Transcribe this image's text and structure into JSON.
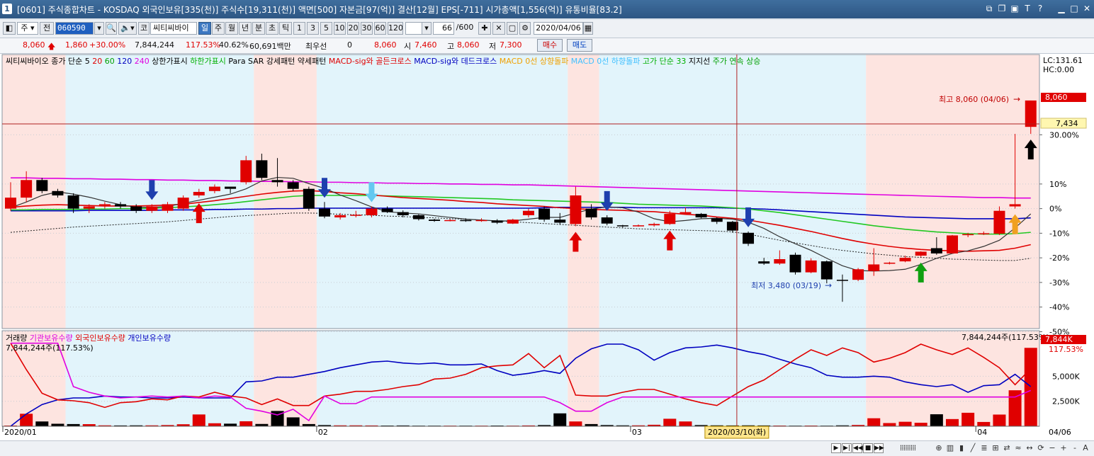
{
  "window": {
    "number": "1",
    "title": "[0601] 주식종합차트 - KOSDAQ 외국인보유[335(천)] 주식수[19,311(천)] 액면[500] 자본금[97(억)] 결산[12월] EPS[-711] 시가총액[1,556(억)] 유통비율[83.2]"
  },
  "toolbar": {
    "type_select": "주",
    "prev_label": "전",
    "code": "060590",
    "market": "코",
    "stock_name": "씨티씨바이",
    "periods": [
      "일",
      "주",
      "월",
      "년",
      "분",
      "초",
      "틱"
    ],
    "selected_period": "일",
    "intervals": [
      "1",
      "3",
      "5",
      "10",
      "20",
      "30",
      "60",
      "120"
    ],
    "count": "66",
    "count_total": "/600",
    "date": "2020/04/06"
  },
  "quote": {
    "price": "8,060",
    "change": "1,860",
    "change_pct": "+30.00%",
    "volume": "7,844,244",
    "vol_ratio": "117.53%",
    "turnover": "40.62%",
    "amount": "60,691백만",
    "priority_label": "최우선",
    "priority_value": "0",
    "ask": "8,060",
    "open_label": "시",
    "open": "7,460",
    "high_label": "고",
    "high": "8,060",
    "low_label": "저",
    "low": "7,300",
    "buy_label": "매수",
    "sell_label": "매도"
  },
  "price_panel": {
    "legend": [
      {
        "text": "씨티씨바이오",
        "color": "#000000"
      },
      {
        "text": "종가 단순 5",
        "color": "#000000"
      },
      {
        "text": "20",
        "color": "#e00000"
      },
      {
        "text": "60",
        "color": "#00a000"
      },
      {
        "text": "120",
        "color": "#0000c0"
      },
      {
        "text": "240",
        "color": "#e000e0"
      },
      {
        "text": "상한가표시",
        "color": "#000000"
      },
      {
        "text": "하한가표시",
        "color": "#00b000"
      },
      {
        "text": "Para SAR 강세패턴",
        "color": "#000000"
      },
      {
        "text": "약세패턴",
        "color": "#000000"
      },
      {
        "text": "MACD-sig와 골든크로스",
        "color": "#e00000"
      },
      {
        "text": "MACD-sig와 데드크로스",
        "color": "#0000c0"
      },
      {
        "text": "MACD 0선 상향돌파",
        "color": "#f0a000"
      },
      {
        "text": "MACD 0선 하향돌파",
        "color": "#40c0ff"
      },
      {
        "text": "고가 단순 33",
        "color": "#00b000"
      },
      {
        "text": "지지선",
        "color": "#000000"
      },
      {
        "text": "주가 연속 상승",
        "color": "#00a000"
      }
    ],
    "lc": "LC:131.61",
    "hc": "HC:0.00",
    "last_price_tag": "8,060",
    "cursor_tag": "7,434",
    "max_label": "최고 8,060 (04/06)",
    "min_label": "최저 3,480 (03/19)",
    "y_ticks": [
      "30.00%",
      "10%",
      "0%",
      "-10%",
      "-20%",
      "-30%",
      "-40%",
      "-50%"
    ]
  },
  "volume_panel": {
    "legend": [
      {
        "text": "거래량",
        "color": "#000000"
      },
      {
        "text": "기관보유수량",
        "color": "#e000e0"
      },
      {
        "text": "외국인보유수량",
        "color": "#e00000"
      },
      {
        "text": "개인보유수량",
        "color": "#0000c0"
      }
    ],
    "left_label": "7,844,244주(117.53%)",
    "right_label": "7,844,244주(117.53%)",
    "tag_value": "7,844K",
    "tag_pct": "117.53%",
    "y_ticks": [
      "5,000K",
      "2,500K"
    ]
  },
  "x_axis": {
    "labels": [
      "2020/01",
      "02",
      "03",
      "04"
    ],
    "last_label": "04/06",
    "cursor_label": "2020/03/10(화)"
  },
  "colors": {
    "up": "#e00000",
    "down": "#000000",
    "bg_pink": "#fde4e0",
    "bg_blue": "#e2f4fb"
  },
  "chart_data": {
    "type": "candlestick",
    "series_name": "씨티씨바이오",
    "ohlc": [
      [
        5600,
        6200,
        5550,
        5850
      ],
      [
        5850,
        6450,
        5750,
        6250
      ],
      [
        6250,
        6300,
        5950,
        6000
      ],
      [
        6000,
        6050,
        5850,
        5900
      ],
      [
        5900,
        5950,
        5500,
        5600
      ],
      [
        5600,
        5700,
        5500,
        5650
      ],
      [
        5650,
        5750,
        5600,
        5700
      ],
      [
        5700,
        5750,
        5600,
        5650
      ],
      [
        5650,
        5700,
        5500,
        5550
      ],
      [
        5550,
        5700,
        5500,
        5650
      ],
      [
        5550,
        5750,
        5500,
        5700
      ],
      [
        5600,
        5900,
        5550,
        5850
      ],
      [
        5900,
        6050,
        5850,
        5980
      ],
      [
        6000,
        6150,
        5950,
        6100
      ],
      [
        6100,
        6050,
        5950,
        6050
      ],
      [
        6200,
        6800,
        6150,
        6700
      ],
      [
        6700,
        6850,
        6250,
        6300
      ],
      [
        6250,
        6750,
        6100,
        6200
      ],
      [
        6200,
        6250,
        6000,
        6050
      ],
      [
        6050,
        6100,
        5550,
        5600
      ],
      [
        5600,
        5750,
        5380,
        5420
      ],
      [
        5400,
        5500,
        5350,
        5450
      ],
      [
        5450,
        5550,
        5400,
        5460
      ],
      [
        5450,
        5650,
        5400,
        5600
      ],
      [
        5600,
        5650,
        5500,
        5520
      ],
      [
        5520,
        5560,
        5400,
        5450
      ],
      [
        5450,
        5470,
        5330,
        5360
      ],
      [
        5350,
        5370,
        5300,
        5320
      ],
      [
        5320,
        5360,
        5310,
        5340
      ],
      [
        5340,
        5380,
        5300,
        5320
      ],
      [
        5330,
        5380,
        5300,
        5340
      ],
      [
        5330,
        5360,
        5250,
        5280
      ],
      [
        5260,
        5370,
        5250,
        5350
      ],
      [
        5450,
        5600,
        5400,
        5550
      ],
      [
        5600,
        5650,
        5300,
        5350
      ],
      [
        5350,
        5500,
        5230,
        5280
      ],
      [
        5250,
        6100,
        5200,
        5900
      ],
      [
        5600,
        5700,
        5350,
        5400
      ],
      [
        5400,
        5450,
        5220,
        5260
      ],
      [
        5220,
        5230,
        5170,
        5200
      ],
      [
        5220,
        5240,
        5190,
        5220
      ],
      [
        5220,
        5280,
        5190,
        5250
      ],
      [
        5250,
        5550,
        5230,
        5480
      ],
      [
        5480,
        5620,
        5460,
        5520
      ],
      [
        5480,
        5500,
        5380,
        5400
      ],
      [
        5380,
        5400,
        5250,
        5300
      ],
      [
        5300,
        5320,
        5050,
        5100
      ],
      [
        5050,
        5080,
        4750,
        4800
      ],
      [
        4400,
        4480,
        4320,
        4350
      ],
      [
        4350,
        4650,
        4320,
        4450
      ],
      [
        4550,
        4600,
        4100,
        4150
      ],
      [
        4150,
        4470,
        4130,
        4420
      ],
      [
        4400,
        4420,
        3900,
        3990
      ],
      [
        3980,
        4100,
        3480,
        3970
      ],
      [
        3980,
        4250,
        3950,
        4220
      ],
      [
        4180,
        4700,
        4070,
        4330
      ],
      [
        4350,
        4390,
        4330,
        4370
      ],
      [
        4400,
        4530,
        4380,
        4480
      ],
      [
        4530,
        4630,
        4500,
        4620
      ],
      [
        4700,
        4950,
        4550,
        4580
      ],
      [
        4580,
        5000,
        4580,
        4990
      ],
      [
        5010,
        5050,
        4950,
        5020
      ],
      [
        5020,
        5080,
        5000,
        5040
      ],
      [
        5030,
        5650,
        5000,
        5550
      ],
      [
        5650,
        7300,
        5600,
        5700
      ],
      [
        7460,
        8060,
        7300,
        8060
      ]
    ],
    "volume": [
      70,
      1250,
      480,
      250,
      220,
      210,
      90,
      80,
      90,
      90,
      120,
      200,
      1180,
      300,
      260,
      500,
      230,
      1530,
      890,
      220,
      120,
      90,
      90,
      80,
      70,
      80,
      60,
      60,
      60,
      60,
      60,
      70,
      60,
      80,
      120,
      1290,
      480,
      220,
      120,
      90,
      90,
      150,
      750,
      480,
      120,
      90,
      80,
      90,
      80,
      70,
      60,
      70,
      60,
      90,
      130,
      800,
      320,
      450,
      350,
      1200,
      720,
      1350,
      430,
      1170,
      3600,
      7844
    ],
    "ma": {
      "5": [
        5620,
        5750,
        5900,
        5980,
        5930,
        5860,
        5770,
        5690,
        5630,
        5630,
        5650,
        5720,
        5790,
        5860,
        5930,
        6050,
        6230,
        6310,
        6290,
        6170,
        6060,
        5910,
        5780,
        5640,
        5530,
        5500,
        5480,
        5440,
        5400,
        5360,
        5340,
        5320,
        5320,
        5360,
        5400,
        5400,
        5500,
        5590,
        5640,
        5620,
        5520,
        5370,
        5300,
        5330,
        5370,
        5380,
        5360,
        5290,
        5150,
        4960,
        4800,
        4650,
        4470,
        4300,
        4190,
        4180,
        4190,
        4220,
        4330,
        4470,
        4580,
        4640,
        4740,
        4880,
        5160,
        5480
      ],
      "20": [
        5630,
        5660,
        5680,
        5690,
        5680,
        5670,
        5660,
        5660,
        5660,
        5670,
        5680,
        5700,
        5740,
        5780,
        5830,
        5880,
        5930,
        5970,
        6000,
        6010,
        5990,
        5960,
        5940,
        5910,
        5880,
        5850,
        5830,
        5810,
        5790,
        5760,
        5740,
        5710,
        5690,
        5670,
        5650,
        5620,
        5600,
        5580,
        5570,
        5560,
        5540,
        5530,
        5500,
        5470,
        5450,
        5410,
        5380,
        5340,
        5280,
        5220,
        5150,
        5080,
        5000,
        4920,
        4850,
        4790,
        4740,
        4700,
        4670,
        4650,
        4640,
        4630,
        4640,
        4650,
        4700,
        4780
      ],
      "60": [
        5570,
        5570,
        5580,
        5580,
        5580,
        5590,
        5590,
        5600,
        5600,
        5610,
        5620,
        5640,
        5660,
        5690,
        5720,
        5760,
        5800,
        5840,
        5880,
        5900,
        5900,
        5900,
        5900,
        5900,
        5890,
        5880,
        5870,
        5860,
        5850,
        5840,
        5830,
        5820,
        5800,
        5790,
        5780,
        5770,
        5760,
        5750,
        5740,
        5720,
        5700,
        5690,
        5680,
        5670,
        5660,
        5640,
        5620,
        5590,
        5550,
        5510,
        5460,
        5410,
        5360,
        5310,
        5260,
        5210,
        5170,
        5130,
        5100,
        5070,
        5050,
        5030,
        5020,
        5020,
        5030,
        5060
      ],
      "120": [
        5550,
        5550,
        5550,
        5550,
        5550,
        5560,
        5560,
        5560,
        5560,
        5560,
        5570,
        5570,
        5570,
        5580,
        5580,
        5590,
        5590,
        5600,
        5600,
        5610,
        5610,
        5610,
        5610,
        5610,
        5610,
        5610,
        5610,
        5610,
        5610,
        5610,
        5610,
        5610,
        5610,
        5610,
        5620,
        5630,
        5630,
        5630,
        5630,
        5630,
        5620,
        5620,
        5620,
        5620,
        5620,
        5620,
        5610,
        5600,
        5590,
        5570,
        5550,
        5530,
        5510,
        5490,
        5470,
        5450,
        5430,
        5410,
        5400,
        5390,
        5380,
        5370,
        5370,
        5370,
        5370,
        5390
      ],
      "240": [
        6300,
        6300,
        6290,
        6290,
        6280,
        6280,
        6270,
        6270,
        6260,
        6260,
        6250,
        6250,
        6240,
        6240,
        6230,
        6230,
        6220,
        6220,
        6210,
        6210,
        6200,
        6200,
        6190,
        6190,
        6180,
        6180,
        6170,
        6170,
        6160,
        6160,
        6150,
        6150,
        6140,
        6140,
        6130,
        6120,
        6110,
        6100,
        6090,
        6080,
        6070,
        6060,
        6050,
        6040,
        6030,
        6020,
        6010,
        6000,
        5990,
        5980,
        5970,
        5960,
        5950,
        5940,
        5930,
        5920,
        5910,
        5900,
        5890,
        5880,
        5870,
        5860,
        5850,
        5850,
        5840,
        5840
      ]
    },
    "support_line": [
      5060,
      5090,
      5120,
      5150,
      5180,
      5200,
      5220,
      5240,
      5260,
      5280,
      5300,
      5330,
      5360,
      5390,
      5420,
      5440,
      5460,
      5480,
      5500,
      5500,
      5490,
      5470,
      5460,
      5450,
      5430,
      5420,
      5400,
      5390,
      5370,
      5360,
      5340,
      5320,
      5300,
      5280,
      5260,
      5240,
      5220,
      5200,
      5180,
      5160,
      5140,
      5130,
      5120,
      5110,
      5100,
      5090,
      5070,
      5020,
      4950,
      4880,
      4820,
      4760,
      4700,
      4650,
      4610,
      4570,
      4540,
      4510,
      4490,
      4470,
      4450,
      4440,
      4430,
      4420,
      4420,
      4470
    ],
    "holdings": {
      "institution": [
        8.8,
        8.8,
        8.8,
        8.8,
        4.2,
        3.6,
        3.2,
        3.0,
        3.1,
        3.2,
        3.1,
        3.2,
        3.0,
        3.2,
        3.1,
        1.9,
        1.6,
        1.2,
        1.8,
        0.6,
        3.2,
        2.4,
        2.4,
        3.1,
        3.1,
        3.1,
        3.1,
        3.1,
        3.1,
        3.1,
        3.1,
        3.1,
        3.1,
        3.1,
        3.1,
        2.5,
        1.6,
        1.6,
        2.5,
        3.1,
        3.1,
        3.1,
        3.1,
        3.1,
        3.1,
        3.1,
        3.1,
        3.1,
        3.1,
        3.1,
        3.1,
        3.1,
        3.1,
        3.1,
        3.1,
        3.1,
        3.1,
        3.1,
        3.1,
        3.1,
        3.1,
        3.1,
        3.1,
        3.1,
        3.1,
        3.8
      ],
      "foreign": [
        8.8,
        6.0,
        3.5,
        2.8,
        2.7,
        2.5,
        2.0,
        2.5,
        2.6,
        2.9,
        2.8,
        3.2,
        3.1,
        3.6,
        3.2,
        3.0,
        2.3,
        2.9,
        2.2,
        2.2,
        3.2,
        3.4,
        3.7,
        3.7,
        3.9,
        4.2,
        4.4,
        5.0,
        5.1,
        5.5,
        6.2,
        6.4,
        6.5,
        7.7,
        6.2,
        7.5,
        3.3,
        3.2,
        3.2,
        3.6,
        3.9,
        3.9,
        3.4,
        2.9,
        2.5,
        2.2,
        3.2,
        4.2,
        4.9,
        6.0,
        7.1,
        8.1,
        7.5,
        8.3,
        7.8,
        6.8,
        7.2,
        7.8,
        8.7,
        8.1,
        7.6,
        8.3,
        7.3,
        6.2,
        4.4,
        6.1
      ],
      "individual": [
        0.0,
        1.3,
        2.3,
        2.8,
        3.0,
        3.0,
        3.2,
        3.1,
        3.1,
        3.0,
        3.0,
        3.1,
        3.0,
        3.0,
        3.0,
        4.7,
        4.8,
        5.2,
        5.2,
        5.5,
        5.8,
        6.2,
        6.5,
        6.8,
        6.9,
        6.7,
        6.6,
        6.7,
        6.5,
        6.5,
        6.6,
        5.9,
        5.4,
        5.6,
        5.9,
        5.6,
        7.2,
        8.2,
        8.7,
        8.7,
        8.1,
        7.0,
        7.8,
        8.3,
        8.4,
        8.6,
        8.3,
        7.9,
        7.6,
        7.1,
        6.6,
        6.2,
        5.4,
        5.2,
        5.2,
        5.3,
        5.2,
        4.7,
        4.4,
        4.2,
        4.4,
        3.6,
        4.3,
        4.4,
        5.5,
        4.2
      ]
    },
    "arrows": [
      {
        "i": 9,
        "dir": "down",
        "color": "#1e3fae"
      },
      {
        "i": 12,
        "dir": "up",
        "color": "#e00000"
      },
      {
        "i": 20,
        "dir": "down",
        "color": "#1e3fae"
      },
      {
        "i": 23,
        "dir": "down",
        "color": "#64c8f0"
      },
      {
        "i": 36,
        "dir": "up",
        "color": "#e00000"
      },
      {
        "i": 38,
        "dir": "down",
        "color": "#1e3fae"
      },
      {
        "i": 42,
        "dir": "up",
        "color": "#e00000"
      },
      {
        "i": 47,
        "dir": "down",
        "color": "#1e3fae"
      },
      {
        "i": 58,
        "dir": "up",
        "color": "#10a010"
      },
      {
        "i": 64,
        "dir": "up",
        "color": "#f0a020"
      },
      {
        "i": 65,
        "dir": "up",
        "color": "#000000"
      }
    ],
    "background_bands": [
      {
        "from": 0,
        "to": 3,
        "color": "pink"
      },
      {
        "from": 4,
        "to": 15,
        "color": "blue"
      },
      {
        "from": 16,
        "to": 19,
        "color": "pink"
      },
      {
        "from": 20,
        "to": 35,
        "color": "blue"
      },
      {
        "from": 36,
        "to": 37,
        "color": "pink"
      },
      {
        "from": 38,
        "to": 54,
        "color": "blue"
      },
      {
        "from": 55,
        "to": 65,
        "color": "pink"
      }
    ],
    "x_label_positions": [
      0,
      20,
      40,
      62
    ],
    "cursor_index": 46,
    "price_range": [
      3000,
      8800
    ],
    "volume_max": 8500,
    "base_price": 5600
  }
}
